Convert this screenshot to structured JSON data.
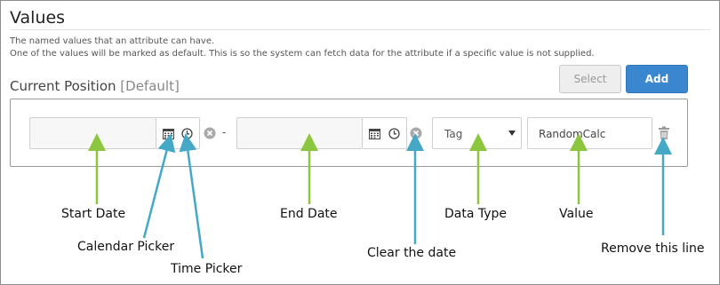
{
  "section": {
    "title": "Values",
    "description_line1": "The named values that an attribute can have.",
    "description_line2": "One of the values will be marked as default. This is so the system can fetch data for the attribute if a specific value is not supplied."
  },
  "attribute": {
    "name": "Current Position",
    "default_tag": "[Default]"
  },
  "buttons": {
    "select_label": "Select",
    "add_label": "Add"
  },
  "row": {
    "start_date": "",
    "end_date": "",
    "separator": "-",
    "data_type": "Tag",
    "value": "RandomCalc"
  },
  "annotations": {
    "start_date": "Start Date",
    "calendar_picker": "Calendar Picker",
    "time_picker": "Time Picker",
    "end_date": "End Date",
    "clear_date": "Clear the date",
    "data_type": "Data Type",
    "value": "Value",
    "remove_line": "Remove this line"
  },
  "colors": {
    "add_button": "#3a87d0",
    "green_arrow": "#8cc63f",
    "blue_arrow": "#45a9c6"
  }
}
